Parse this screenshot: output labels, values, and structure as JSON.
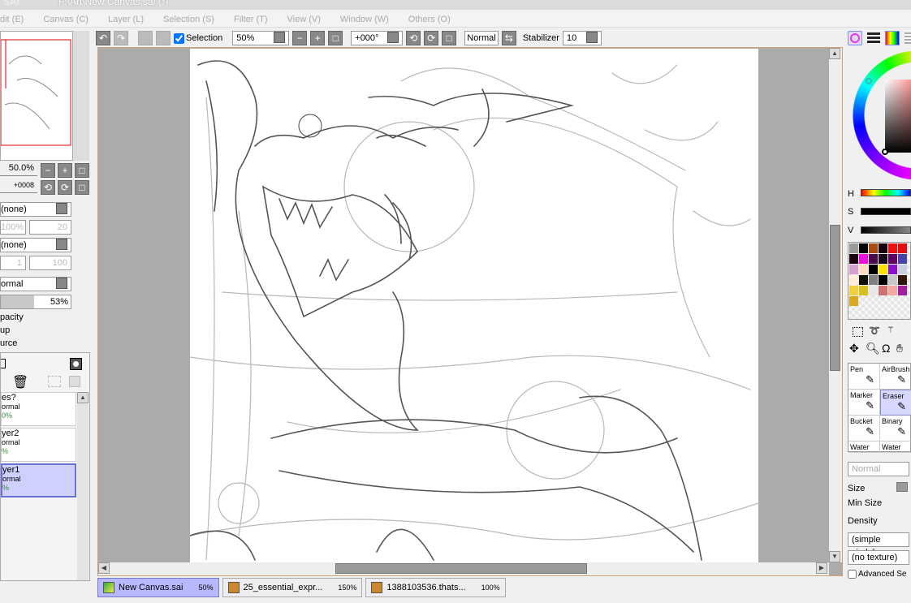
{
  "window": {
    "title": "F:\\Art\\New Canvas.sai (*)",
    "logo": "SAI"
  },
  "menu": [
    "dit (E)",
    "Canvas (C)",
    "Layer (L)",
    "Selection (S)",
    "Filter (T)",
    "View (V)",
    "Window (W)",
    "Others (O)"
  ],
  "toolbar": {
    "selection_label": "Selection",
    "selection_checked": true,
    "zoom": "50%",
    "rotation": "+000°",
    "blend": "Normal",
    "stabilizer_label": "Stabilizer",
    "stabilizer": "10"
  },
  "navigator": {
    "zoom": "50.0%",
    "angle": "+0008"
  },
  "layer_props": {
    "texture": "(none)",
    "texture_scale": "100%",
    "texture_strength": "20",
    "effect": "(none)",
    "effect_width": "1",
    "effect_strength": "100",
    "mode": "ormal",
    "opacity": "53%",
    "opacity_value": 53,
    "checks": [
      "pacity",
      "up",
      "urce"
    ]
  },
  "layers": [
    {
      "name": "es?",
      "mode": "ormal",
      "opacity": "0%"
    },
    {
      "name": "yer2",
      "mode": "ormal",
      "opacity": "%"
    },
    {
      "name": "yer1",
      "mode": "ormal",
      "opacity": "%"
    }
  ],
  "tabs": [
    {
      "name": "New Canvas.sai",
      "zoom": "50%",
      "active": true
    },
    {
      "name": "25_essential_expr...",
      "zoom": "150%"
    },
    {
      "name": "1388103536.thats...",
      "zoom": "100%"
    }
  ],
  "color": {
    "h_label": "H",
    "s_label": "S",
    "v_label": "V",
    "swatches": [
      "#9a9a9a",
      "#000000",
      "#a84c10",
      "#1a0008",
      "#ee1111",
      "#e01010",
      "#1a0010",
      "#ee11dd",
      "#4a0a4a",
      "#180818",
      "#600060",
      "#4444aa",
      "#d8a0d0",
      "#ffe0c0",
      "#000000",
      "#ffe000",
      "#8811cc",
      "#c8d0e0",
      "#ffeedd",
      "#101008",
      "#808080",
      "#000000",
      "#c8c8c8",
      "#301808",
      "#f0d040",
      "#d8c020",
      "#e8e8e8",
      "#d07070",
      "#f0a8a0",
      "#a020a0",
      "#d8a820"
    ]
  },
  "tools": {
    "row1": [
      "Pen",
      "AirBrush"
    ],
    "row2": [
      "Marker",
      "Eraser"
    ],
    "row3": [
      "Bucket",
      "Binary"
    ],
    "row4": [
      "Water",
      "Water"
    ],
    "selected": "Eraser"
  },
  "brush": {
    "mode": "Normal",
    "size_label": "Size",
    "min_size_label": "Min Size",
    "density_label": "Density",
    "shape": "(simple circle)",
    "texture": "(no texture)",
    "advanced": "Advanced Se"
  }
}
